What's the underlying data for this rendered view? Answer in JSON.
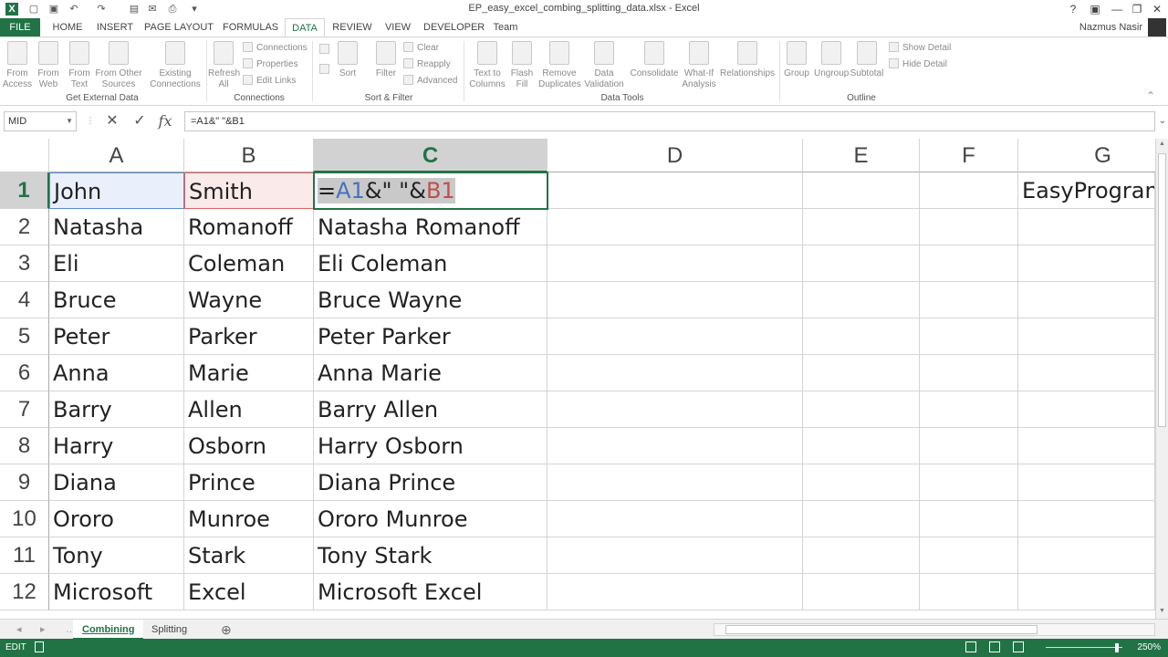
{
  "window": {
    "title": "EP_easy_excel_combing_splitting_data.xlsx - Excel",
    "user": "Nazmus Nasir",
    "controls": [
      "?",
      "▣",
      "—",
      "❐",
      "✕"
    ]
  },
  "tabs": [
    "FILE",
    "HOME",
    "INSERT",
    "PAGE LAYOUT",
    "FORMULAS",
    "DATA",
    "REVIEW",
    "VIEW",
    "DEVELOPER",
    "Team"
  ],
  "ribbon": {
    "get_external": {
      "from_access": "From Access",
      "from_web": "From Web",
      "from_text": "From Text",
      "from_other": "From Other Sources",
      "existing": "Existing Connections",
      "label": "Get External Data"
    },
    "connections": {
      "refresh": "Refresh All",
      "conn": "Connections",
      "props": "Properties",
      "edit_links": "Edit Links",
      "label": "Connections"
    },
    "sort_filter": {
      "sort": "Sort",
      "filter": "Filter",
      "clear": "Clear",
      "reapply": "Reapply",
      "advanced": "Advanced",
      "label": "Sort & Filter"
    },
    "data_tools": {
      "text_to_columns": "Text to Columns",
      "flash_fill": "Flash Fill",
      "remove_dup": "Remove Duplicates",
      "validation": "Data Validation",
      "consolidate": "Consolidate",
      "what_if": "What-If Analysis",
      "relationships": "Relationships",
      "label": "Data Tools"
    },
    "outline": {
      "group": "Group",
      "ungroup": "Ungroup",
      "subtotal": "Subtotal",
      "show_detail": "Show Detail",
      "hide_detail": "Hide Detail",
      "label": "Outline"
    }
  },
  "formula_bar": {
    "name_box": "MID",
    "formula": "=A1&\" \"&B1"
  },
  "grid": {
    "columns": [
      "A",
      "B",
      "C",
      "D",
      "E",
      "F",
      "G"
    ],
    "rows": [
      {
        "n": "1",
        "a": "John",
        "b": "Smith",
        "c": ""
      },
      {
        "n": "2",
        "a": "Natasha",
        "b": "Romanoff",
        "c": "Natasha Romanoff"
      },
      {
        "n": "3",
        "a": "Eli",
        "b": "Coleman",
        "c": "Eli Coleman"
      },
      {
        "n": "4",
        "a": "Bruce",
        "b": "Wayne",
        "c": "Bruce Wayne"
      },
      {
        "n": "5",
        "a": "Peter",
        "b": "Parker",
        "c": "Peter Parker"
      },
      {
        "n": "6",
        "a": "Anna",
        "b": "Marie",
        "c": "Anna Marie"
      },
      {
        "n": "7",
        "a": "Barry",
        "b": "Allen",
        "c": "Barry Allen"
      },
      {
        "n": "8",
        "a": "Harry",
        "b": "Osborn",
        "c": "Harry Osborn"
      },
      {
        "n": "9",
        "a": "Diana",
        "b": "Prince",
        "c": "Diana Prince"
      },
      {
        "n": "10",
        "a": "Ororo",
        "b": "Munroe",
        "c": "Ororo Munroe"
      },
      {
        "n": "11",
        "a": "Tony",
        "b": "Stark",
        "c": "Tony Stark"
      },
      {
        "n": "12",
        "a": "Microsoft",
        "b": "Excel",
        "c": "Microsoft Excel"
      }
    ],
    "g1": "EasyProgrammin",
    "c1_formula": {
      "eq": "=",
      "ref_a": "A1",
      "mid": "&\" \"&",
      "ref_b": "B1"
    }
  },
  "sheets": [
    "Combining",
    "Splitting"
  ],
  "status": {
    "mode": "EDIT",
    "zoom": "250%"
  },
  "colors": {
    "accent": "#217346",
    "ref_a": "#4472c4",
    "ref_b": "#c0504d"
  }
}
